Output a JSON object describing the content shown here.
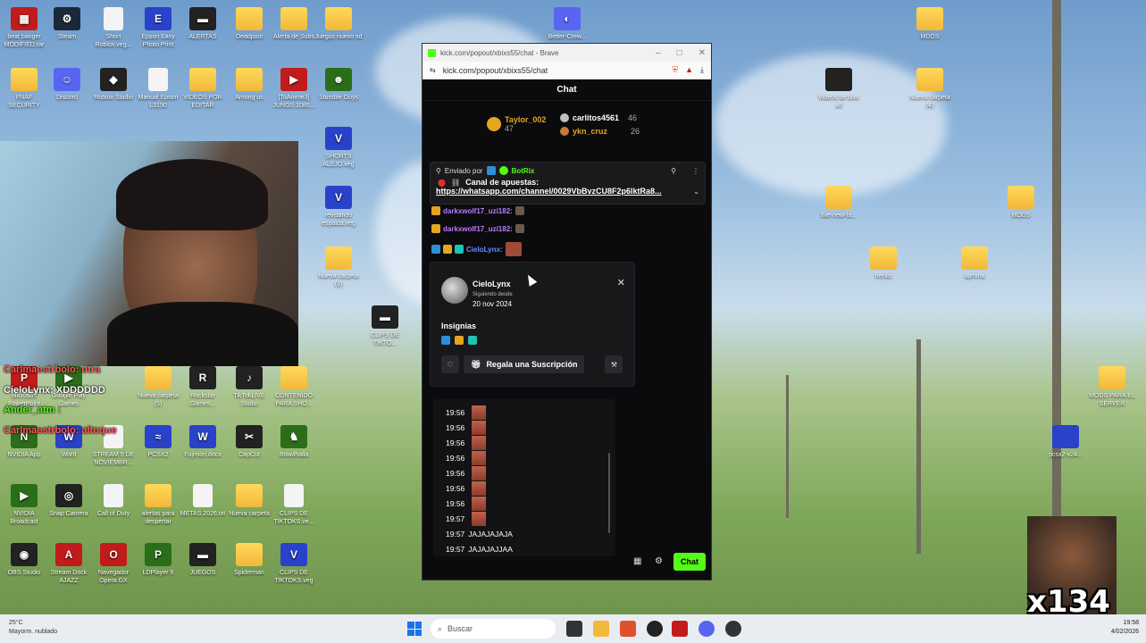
{
  "desktop": {
    "icons_left": [
      {
        "label": "beat banger MODIFIED.rar",
        "type": "app-red",
        "glyph": "▦"
      },
      {
        "label": "Steam",
        "type": "app-steam",
        "glyph": "⚙"
      },
      {
        "label": "Short Roblox.veg...",
        "type": "doc",
        "glyph": ""
      },
      {
        "label": "Epson Easy Photo Print",
        "type": "app-v",
        "glyph": "E"
      },
      {
        "label": "ALERTAS",
        "type": "app-dark",
        "glyph": "▬"
      },
      {
        "label": "Deadpool",
        "type": "folder",
        "glyph": ""
      },
      {
        "label": "Alerta de Subs",
        "type": "folder",
        "glyph": ""
      },
      {
        "label": "Juegos nuevo xd",
        "type": "folder",
        "glyph": ""
      },
      {
        "label": "FNAF SECURITY",
        "type": "folder",
        "glyph": ""
      },
      {
        "label": "Discord",
        "type": "app-discord",
        "glyph": "☺"
      },
      {
        "label": "Roblox Studio",
        "type": "app-roblox",
        "glyph": "◆"
      },
      {
        "label": "Manual Epson L3150",
        "type": "doc",
        "glyph": ""
      },
      {
        "label": "VIDEOS POR EDITAR",
        "type": "folder",
        "glyph": ""
      },
      {
        "label": "Among us",
        "type": "folder",
        "glyph": ""
      },
      {
        "label": "[ToAnime3] JUNGS 1080...",
        "type": "app-red",
        "glyph": "▶"
      },
      {
        "label": "Stumble Guys",
        "type": "app-green",
        "glyph": "☻"
      },
      {
        "label": "Microsoft PowerPoint",
        "type": "app-red",
        "glyph": "P"
      },
      {
        "label": "Google Play Games",
        "type": "app-green",
        "glyph": "▶"
      },
      {
        "label": "Rockstar Games...",
        "type": "app-dark",
        "glyph": "R"
      },
      {
        "label": "TikTokLIVE Studio",
        "type": "app-dark",
        "glyph": "♪"
      },
      {
        "label": "CONTENIDO PARA SHO...",
        "type": "folder",
        "glyph": ""
      },
      {
        "label": "Nueva carpeta (5)",
        "type": "folder",
        "glyph": ""
      },
      {
        "label": "NVIDIA App",
        "type": "app-green",
        "glyph": "N"
      },
      {
        "label": "Word",
        "type": "app-v",
        "glyph": "W"
      },
      {
        "label": "STREAM 5 DE NOVIEMBR...",
        "type": "doc",
        "glyph": ""
      },
      {
        "label": "PCSX2",
        "type": "app-v",
        "glyph": "≈"
      },
      {
        "label": "Fujimori.docx",
        "type": "app-v",
        "glyph": "W"
      },
      {
        "label": "CapCut",
        "type": "app-dark",
        "glyph": "✂"
      },
      {
        "label": "Brawlhalla",
        "type": "app-green",
        "glyph": "♞"
      },
      {
        "label": "NVIDIA Broadcast",
        "type": "app-green",
        "glyph": "▶"
      },
      {
        "label": "Snap Camera",
        "type": "app-dark",
        "glyph": "◎"
      },
      {
        "label": "Call of Duty",
        "type": "doc",
        "glyph": ""
      },
      {
        "label": "alertas para despertar",
        "type": "folder",
        "glyph": ""
      },
      {
        "label": "METAS 2026.txt",
        "type": "doc",
        "glyph": ""
      },
      {
        "label": "Nueva carpeta",
        "type": "folder",
        "glyph": ""
      },
      {
        "label": "CLIPS DE TIKTOKS.ve...",
        "type": "doc",
        "glyph": ""
      },
      {
        "label": "OBS Studio",
        "type": "app-dark",
        "glyph": "◉"
      },
      {
        "label": "Stream Dock AJAZZ",
        "type": "app-red",
        "glyph": "A"
      },
      {
        "label": "Navegador Opera GX",
        "type": "app-red",
        "glyph": "O"
      },
      {
        "label": "LDPlayer 9",
        "type": "app-green",
        "glyph": "P"
      },
      {
        "label": "JUEGOS",
        "type": "app-dark",
        "glyph": "▬"
      },
      {
        "label": "Spiderman",
        "type": "folder",
        "glyph": ""
      },
      {
        "label": "CLIPS DE TIKTOKS.veg",
        "type": "app-v",
        "glyph": "V"
      },
      {
        "label": "SHORTS ALEJO.veg",
        "type": "app-v",
        "glyph": "V"
      },
      {
        "label": "revisando espalda.veg",
        "type": "app-v",
        "glyph": "V"
      },
      {
        "label": "Nueva carpeta (3)",
        "type": "folder",
        "glyph": ""
      },
      {
        "label": "CLIPS DE TIKTO...",
        "type": "app-dark",
        "glyph": "▬"
      },
      {
        "label": "Better-Crew...",
        "type": "app-discord",
        "glyph": "◐"
      }
    ],
    "icons_right": [
      {
        "label": "MDOS",
        "type": "folder"
      },
      {
        "label": "Videos de bixs xd",
        "type": "app-dark"
      },
      {
        "label": "Nueva carpeta (4)",
        "type": "folder"
      },
      {
        "label": "five-new-fa...",
        "type": "folder"
      },
      {
        "label": "MODS",
        "type": "folder"
      },
      {
        "label": "frenlis",
        "type": "folder"
      },
      {
        "label": "upmina",
        "type": "folder"
      },
      {
        "label": "MODS PARA EL SERVER",
        "type": "folder"
      },
      {
        "label": "pcsx2-v24...",
        "type": "app-v"
      }
    ]
  },
  "overlay_chat": [
    {
      "text": "Carlmaestrbolo: otra"
    },
    {
      "text": "CieloLynx: XDDDDDD"
    },
    {
      "text": "Ander_atm :"
    },
    {
      "text": "Carlmaestrbolo: altoque"
    }
  ],
  "browser": {
    "title": "kick.com/popout/xbixs55/chat - Brave",
    "url": "kick.com/popout/xbixs55/chat",
    "chat_header": "Chat",
    "leaderboard": [
      {
        "name": "Taylor_002",
        "value": "47"
      },
      {
        "name": "carlitos4561",
        "value": "46"
      },
      {
        "name": "ykn_cruz",
        "value": "26"
      }
    ],
    "pinned": {
      "sent_by_label": "Enviado por",
      "sender": "BotRix",
      "title": "Canal de apuestas:",
      "link": "https://whatsapp.com/channel/0029VbBvzCU8F2p6lktRa8..."
    },
    "chat_lines": [
      {
        "user": "darkxwolf17_uzi182:"
      },
      {
        "user": "darkxwolf17_uzi182:"
      },
      {
        "user": "CieloLynx:"
      }
    ],
    "usercard": {
      "username": "CieloLynx",
      "following_label": "Siguiendo desde",
      "following_date": "20 nov 2024",
      "badges_title": "Insignias",
      "gift_label": "Regala una Suscripción"
    },
    "history": [
      {
        "time": "19:56",
        "text": ""
      },
      {
        "time": "19:56",
        "text": ""
      },
      {
        "time": "19:56",
        "text": ""
      },
      {
        "time": "19:56",
        "text": ""
      },
      {
        "time": "19:56",
        "text": ""
      },
      {
        "time": "19:56",
        "text": ""
      },
      {
        "time": "19:56",
        "text": ""
      },
      {
        "time": "19:57",
        "text": ""
      },
      {
        "time": "19:57",
        "text": "JAJAJAJAJA"
      },
      {
        "time": "19:57",
        "text": "JAJAJAJJAA"
      }
    ],
    "send_label": "Chat"
  },
  "taskbar": {
    "weather_temp": "25°C",
    "weather_desc": "Mayorm. nublado",
    "search_placeholder": "Buscar",
    "time": "19:58",
    "date": "4/02/2026"
  },
  "meme_counter": "x134",
  "colors": {
    "kick_green": "#53fc18",
    "chat_bg": "#0b0b0d",
    "username_purple": "#b97cff"
  }
}
